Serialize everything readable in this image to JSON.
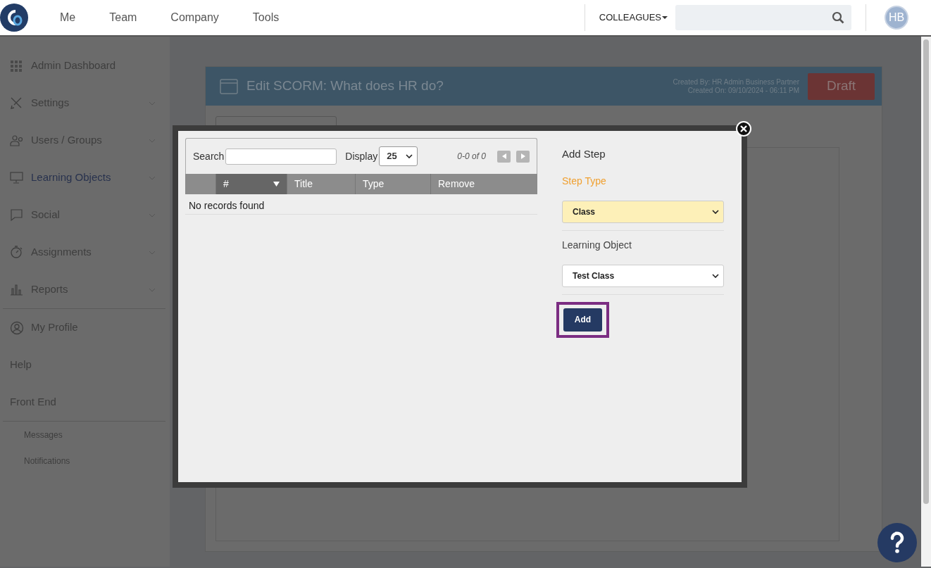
{
  "navbar": {
    "menu": [
      {
        "label": "Me"
      },
      {
        "label": "Team"
      },
      {
        "label": "Company"
      },
      {
        "label": "Tools"
      }
    ],
    "dropdown": "COLLEAGUES",
    "avatar": "HB"
  },
  "sidebar": {
    "groups": [
      {
        "kind": "main",
        "items": [
          {
            "label": "Admin Dashboard",
            "submenu": false,
            "selected": false
          },
          {
            "label": "Settings",
            "submenu": true,
            "selected": false
          },
          {
            "label": "Users / Groups",
            "submenu": true,
            "selected": false
          },
          {
            "label": "Learning Objects",
            "submenu": true,
            "selected": true
          },
          {
            "label": "Social",
            "submenu": true,
            "selected": false
          },
          {
            "label": "Assignments",
            "submenu": true,
            "selected": false
          },
          {
            "label": "Reports",
            "submenu": true,
            "selected": false
          }
        ]
      },
      {
        "kind": "main",
        "items": [
          {
            "label": "My Profile",
            "submenu": false,
            "selected": false
          },
          {
            "label": "Help",
            "submenu": false,
            "selected": false
          },
          {
            "label": "Front End",
            "submenu": false,
            "selected": false
          }
        ]
      },
      {
        "kind": "sub",
        "items": [
          {
            "label": "Messages",
            "submenu": false,
            "selected": false
          },
          {
            "label": "Notifications",
            "submenu": false,
            "selected": false
          }
        ]
      }
    ]
  },
  "page": {
    "title": "Edit SCORM: What does HR do?",
    "created_by": "Created By: HR Admin Business Partner",
    "created_on": "Created On: 09/10/2024 - 06:11 PM",
    "status": "Draft"
  },
  "modal": {
    "search_label": "Search",
    "display_label": "Display",
    "display_value": "25",
    "pager": "0-0 of 0",
    "columns": [
      {
        "label": "#",
        "sorted": true
      },
      {
        "label": "Title",
        "sorted": false
      },
      {
        "label": "Type",
        "sorted": false
      },
      {
        "label": "Remove",
        "sorted": false
      }
    ],
    "empty_message": "No records found",
    "heading": "Add Step",
    "fields": [
      {
        "label": "Step Type",
        "value": "Class",
        "highlighted": true
      },
      {
        "label": "Learning Object",
        "value": "Test Class",
        "highlighted": false
      }
    ],
    "add_button": {
      "label": "Add",
      "focused": true
    }
  }
}
